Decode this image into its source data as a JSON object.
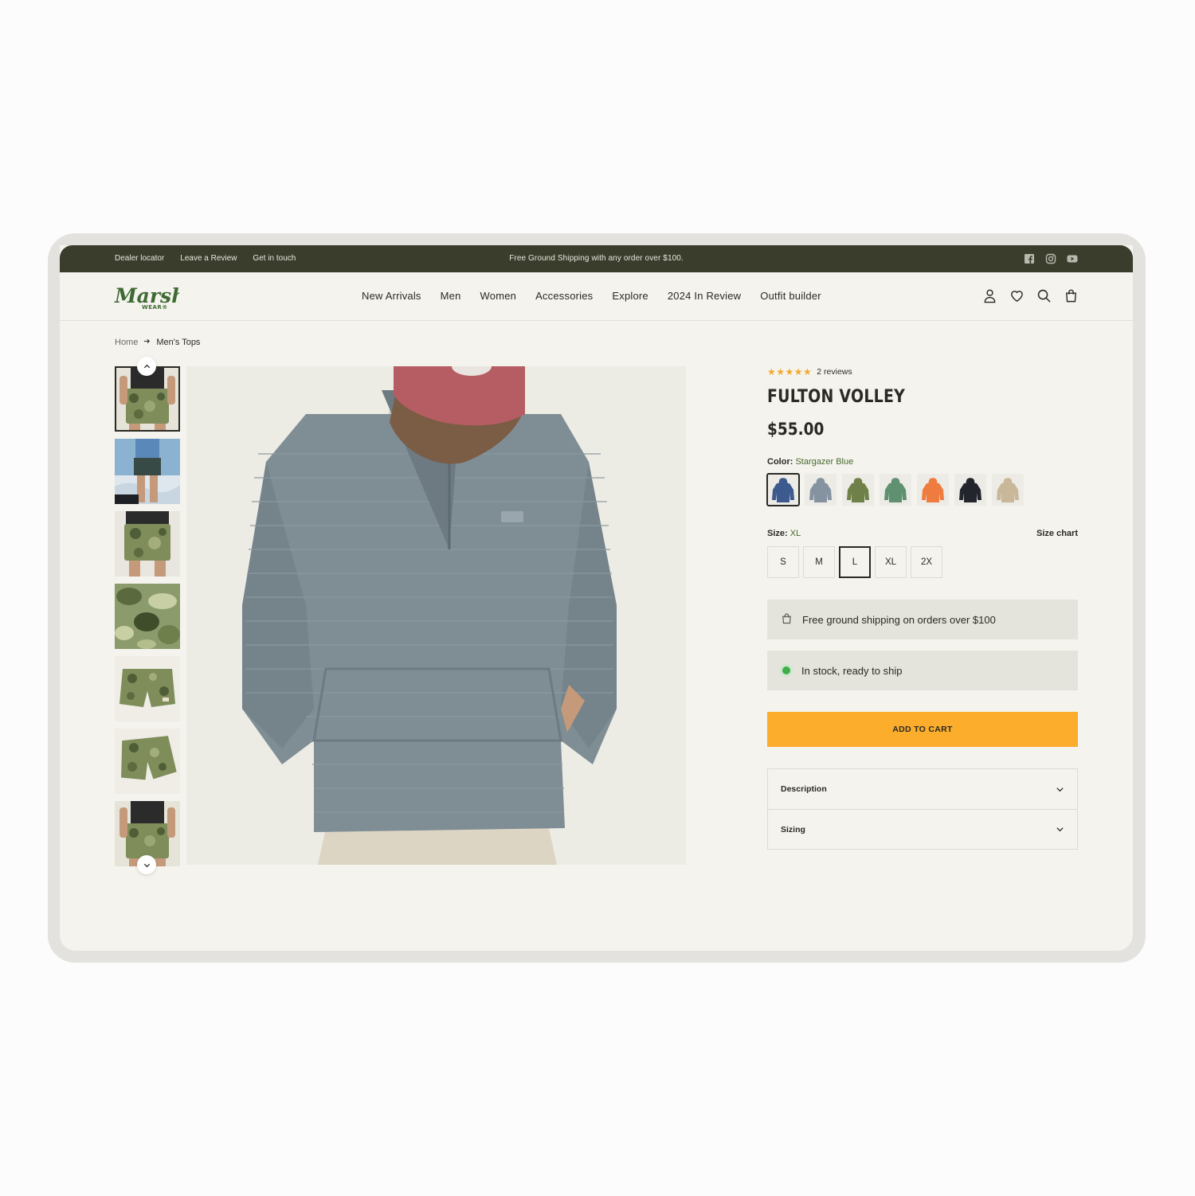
{
  "topbar": {
    "links": [
      "Dealer locator",
      "Leave a Review",
      "Get in touch"
    ],
    "promo": "Free Ground Shipping with any order over $100.",
    "social_icons": [
      "facebook-icon",
      "instagram-icon",
      "youtube-icon"
    ]
  },
  "header": {
    "logo_text": "Marsh",
    "logo_sub": "WEAR®",
    "nav": [
      "New Arrivals",
      "Men",
      "Women",
      "Accessories",
      "Explore",
      "2024 In Review",
      "Outfit builder"
    ],
    "icons": [
      "account-icon",
      "wishlist-icon",
      "search-icon",
      "cart-icon"
    ]
  },
  "breadcrumb": {
    "home": "Home",
    "current": "Men's Tops"
  },
  "gallery": {
    "thumb_count": 7,
    "active_index": 0
  },
  "product": {
    "stars": "★★★★★",
    "rating": 5,
    "reviews": "2 reviews",
    "title": "FULTON VOLLEY",
    "price": "$55.00",
    "color_label": "Color:",
    "color_value": "Stargazer Blue",
    "swatch_colors": [
      "#3d5a8f",
      "#8592a0",
      "#6f8048",
      "#5f9070",
      "#ef7b3f",
      "#23252d",
      "#c9b79a"
    ],
    "size_label": "Size:",
    "size_value": "XL",
    "size_chart": "Size chart",
    "sizes": [
      "S",
      "M",
      "L",
      "XL",
      "2X"
    ],
    "selected_size": "L",
    "shipping_notice": "Free ground shipping on orders over $100",
    "stock_notice": "In stock, ready to ship",
    "add_to_cart": "ADD TO CART",
    "accordion": [
      "Description",
      "Sizing"
    ]
  },
  "colors": {
    "topbar_bg": "#3a3d2c",
    "page_bg": "#f4f3ed",
    "accent": "#fbad2b",
    "brand_green": "#4a6b2f",
    "star": "#f4a72b"
  }
}
